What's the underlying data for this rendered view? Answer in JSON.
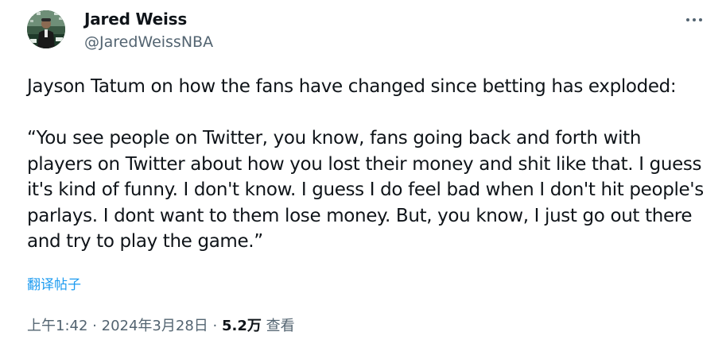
{
  "author": {
    "display_name": "Jared Weiss",
    "handle": "@JaredWeissNBA",
    "avatar_icon": "profile-photo"
  },
  "tweet": {
    "paragraphs": [
      "Jayson Tatum on how the fans have changed since betting has exploded:",
      "“You see people on Twitter, you know, fans going back and forth with players on Twitter about how you lost their money and shit like that. I guess it's kind of funny. I don't know. I guess I do feel bad when I don't hit people's parlays. I dont want to them lose money. But, you know, I just go out there and try to play the game.”"
    ],
    "translate_label": "翻译帖子"
  },
  "meta": {
    "time": "上午1:42",
    "separator": "·",
    "date": "2024年3月28日",
    "views_count": "5.2万",
    "views_label": "查看"
  },
  "more_icon": "more-horizontal-icon",
  "colors": {
    "text_primary": "#0f1419",
    "text_secondary": "#536471",
    "link": "#1d9bf0"
  }
}
